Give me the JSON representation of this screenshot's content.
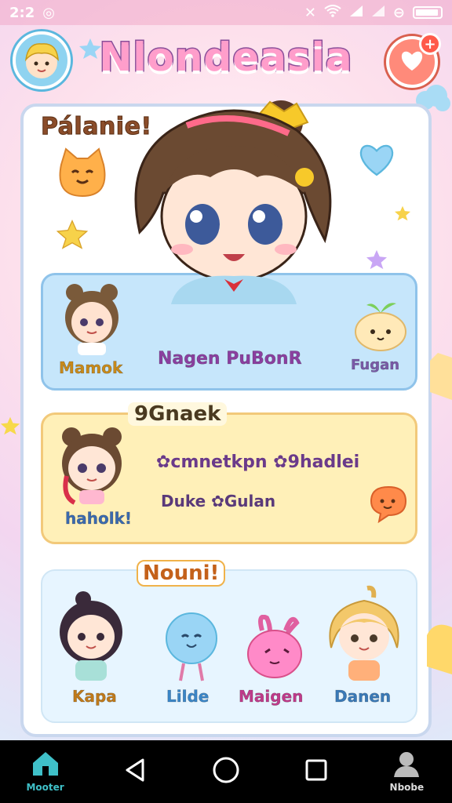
{
  "status_bar": {
    "time": "2:2",
    "extra_icon": "sync-icon",
    "icons": [
      "notification-icon",
      "wifi-icon",
      "signal-icon",
      "signal-icon",
      "alarm-icon",
      "battery-icon"
    ]
  },
  "header": {
    "title": "Nlondeasia",
    "avatar_icon": "profile-avatar-icon",
    "fav_icon": "heart-plus-icon",
    "fav_plus": "+"
  },
  "panel": {
    "title": "Pálanie!",
    "blue_card": {
      "characters": [
        {
          "label": "Mamok",
          "color": "#c88a1a"
        },
        {
          "label": "Nagen PuBonR",
          "color": "#8b3fa0"
        },
        {
          "label": "Fugan",
          "color": "#7a5aa8"
        }
      ]
    },
    "yellow_card": {
      "title": "9Gnaek",
      "character_label": "haholk!",
      "line1": "✿cmnetkpn ✿9hadlei",
      "line2": "Duke ✿Gulan"
    },
    "mint_card": {
      "callout": "Nouni!",
      "characters": [
        {
          "label": "Kapa",
          "color": "#c07a1a"
        },
        {
          "label": "Lilde",
          "color": "#3a86c8"
        },
        {
          "label": "Maigen",
          "color": "#c03a8a"
        },
        {
          "label": "Danen",
          "color": "#3a7ab8"
        }
      ]
    }
  },
  "navbar": {
    "home_label": "Mooter",
    "profile_label": "Nbobe"
  },
  "colors": {
    "accent_pink": "#ff9ecb",
    "heart_red": "#ff8a7a",
    "home_teal": "#3fc0c8"
  }
}
